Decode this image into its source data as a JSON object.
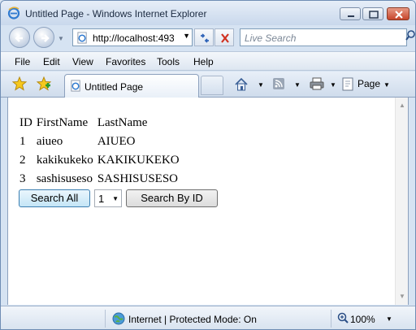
{
  "window": {
    "title": "Untitled Page - Windows Internet Explorer"
  },
  "navigation": {
    "address": "http://localhost:493",
    "search_placeholder": "Live Search"
  },
  "menu": {
    "items": [
      "File",
      "Edit",
      "View",
      "Favorites",
      "Tools",
      "Help"
    ]
  },
  "tabs": {
    "active_label": "Untitled Page",
    "page_menu_label": "Page"
  },
  "content": {
    "table": {
      "headers": [
        "ID",
        "FirstName",
        "LastName"
      ],
      "rows": [
        [
          "1",
          "aiueo",
          "AIUEO"
        ],
        [
          "2",
          "kakikukeko",
          "KAKIKUKEKO"
        ],
        [
          "3",
          "sashisuseso",
          "SASHISUSESO"
        ]
      ]
    },
    "search_all_label": "Search All",
    "id_select_value": "1",
    "search_by_id_label": "Search By ID"
  },
  "status": {
    "zone": "Internet | Protected Mode: On",
    "zoom": "100%"
  },
  "colors": {
    "chrome": "#d6e3f2",
    "close_button": "#c6452a",
    "focused_button": "#c4e5f6"
  }
}
